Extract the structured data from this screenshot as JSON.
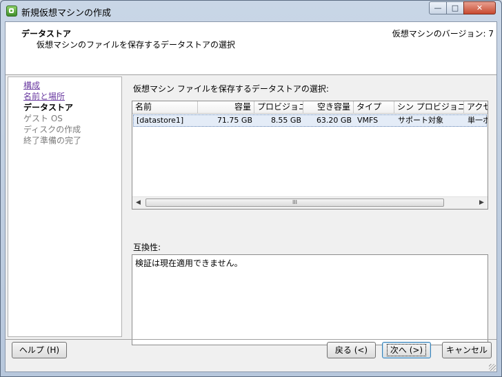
{
  "window": {
    "title": "新規仮想マシンの作成",
    "controls": {
      "minimize": "—",
      "maximize": "□",
      "close": "✕"
    },
    "app_icon": "vsphere-icon"
  },
  "header": {
    "title": "データストア",
    "subtitle": "仮想マシンのファイルを保存するデータストアの選択",
    "version": "仮想マシンのバージョン: 7"
  },
  "steps": [
    {
      "label": "構成",
      "state": "link"
    },
    {
      "label": "名前と場所",
      "state": "link"
    },
    {
      "label": "データストア",
      "state": "current"
    },
    {
      "label": "ゲスト OS",
      "state": "disabled"
    },
    {
      "label": "ディスクの作成",
      "state": "disabled"
    },
    {
      "label": "終了準備の完了",
      "state": "disabled"
    }
  ],
  "main": {
    "select_label": "仮想マシン ファイルを保存するデータストアの選択:",
    "columns": [
      "名前",
      "容量",
      "プロビジョニ…",
      "空き容量",
      "タイプ",
      "シン プロビジョニ…",
      "アクセ"
    ],
    "rows": [
      [
        "[datastore1]",
        "71.75 GB",
        "8.55 GB",
        "63.20 GB",
        "VMFS",
        "サポート対象",
        "単一ホ"
      ]
    ],
    "scroll_left": "◀",
    "scroll_right": "▶",
    "scroll_grip": "III",
    "compat_label": "互換性:",
    "compat_text": "検証は現在適用できません。"
  },
  "buttons": {
    "help": "ヘルプ (H)",
    "back": "戻る (<)",
    "next": "次へ (>)",
    "cancel": "キャンセル"
  }
}
